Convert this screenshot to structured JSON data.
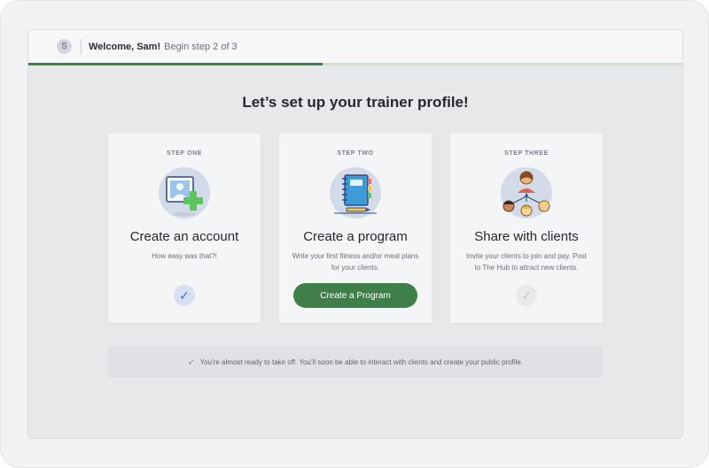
{
  "header": {
    "avatar_initial": "S",
    "welcome": "Welcome, Sam!",
    "step_status": "Begin step 2 of 3",
    "progress": 0.45
  },
  "main": {
    "headline": "Let’s set up your trainer profile!",
    "cards": [
      {
        "label": "STEP ONE",
        "title": "Create an account",
        "description": "How easy was that?!",
        "status": "complete",
        "check": "✓"
      },
      {
        "label": "STEP TWO",
        "title": "Create a program",
        "description": "Write your first fitness and/or meal plans for your clients.",
        "button": "Create a Program"
      },
      {
        "label": "STEP THREE",
        "title": "Share with clients",
        "description": "Invite your clients to join and pay. Post to The Hub to attract new clients.",
        "status": "pending",
        "check": "✓"
      }
    ],
    "banner": "You’re almost ready to take off. You’ll soon be able to interact with clients and create your public profile."
  },
  "colors": {
    "accent": "#3f7f4a",
    "progress_track": "#cfe0d3",
    "check_done_bg": "#d6e0f2"
  },
  "icons": {
    "banner": "rocket-icon",
    "card1": "profile-photo-plus-icon",
    "card2": "notebook-pencil-icon",
    "card3": "clients-network-icon"
  }
}
